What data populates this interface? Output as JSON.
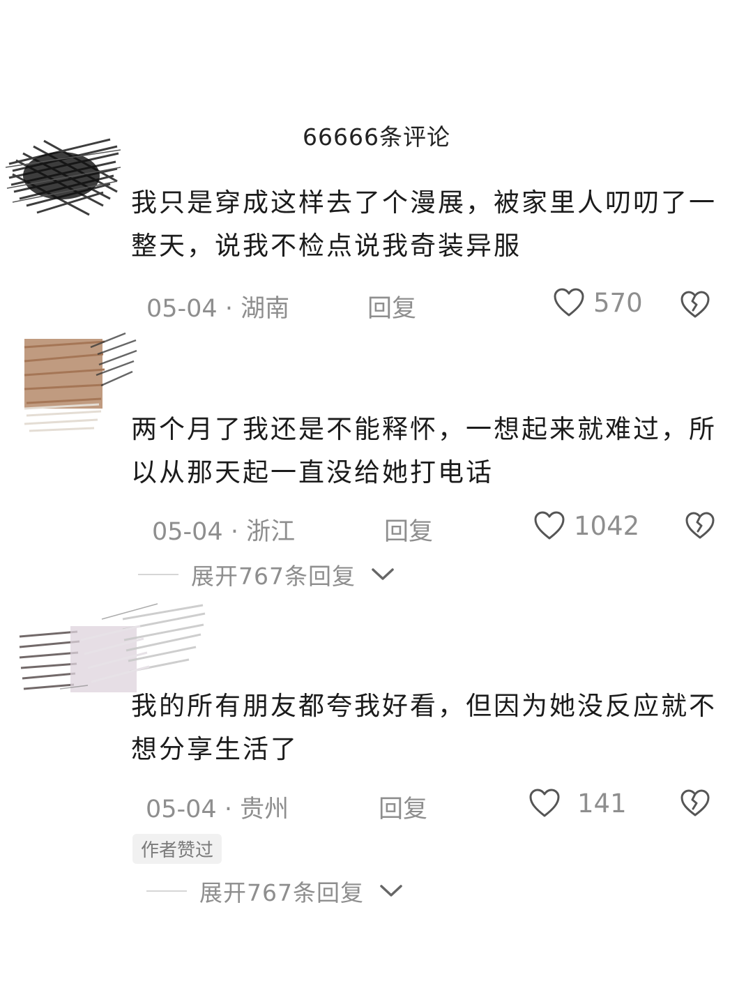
{
  "header": {
    "title": "66666条评论"
  },
  "comments": [
    {
      "text": "我只是穿成这样去了个漫展，被家里人叨叨了一整天，说我不检点说我奇装异服",
      "date": "05-04",
      "location": "湖南",
      "reply_label": "回复",
      "likes": "570",
      "avatar_icon": "avatar-scribble-dark"
    },
    {
      "text": "两个月了我还是不能释怀，一想起来就难过，所以从那天起一直没给她打电话",
      "date": "05-04",
      "location": "浙江",
      "reply_label": "回复",
      "likes": "1042",
      "expand_label": "展开767条回复",
      "avatar_icon": "avatar-scribble-tan"
    },
    {
      "text": "我的所有朋友都夸我好看，但因为她没反应就不想分享生活了",
      "date": "05-04",
      "location": "贵州",
      "reply_label": "回复",
      "likes": "141",
      "badge": "作者赞过",
      "expand_label": "展开767条回复",
      "avatar_icon": "avatar-scribble-light"
    }
  ],
  "colors": {
    "text": "#1b1b1b",
    "meta": "#8e8e8e",
    "badge_bg": "#f1f1f1"
  }
}
